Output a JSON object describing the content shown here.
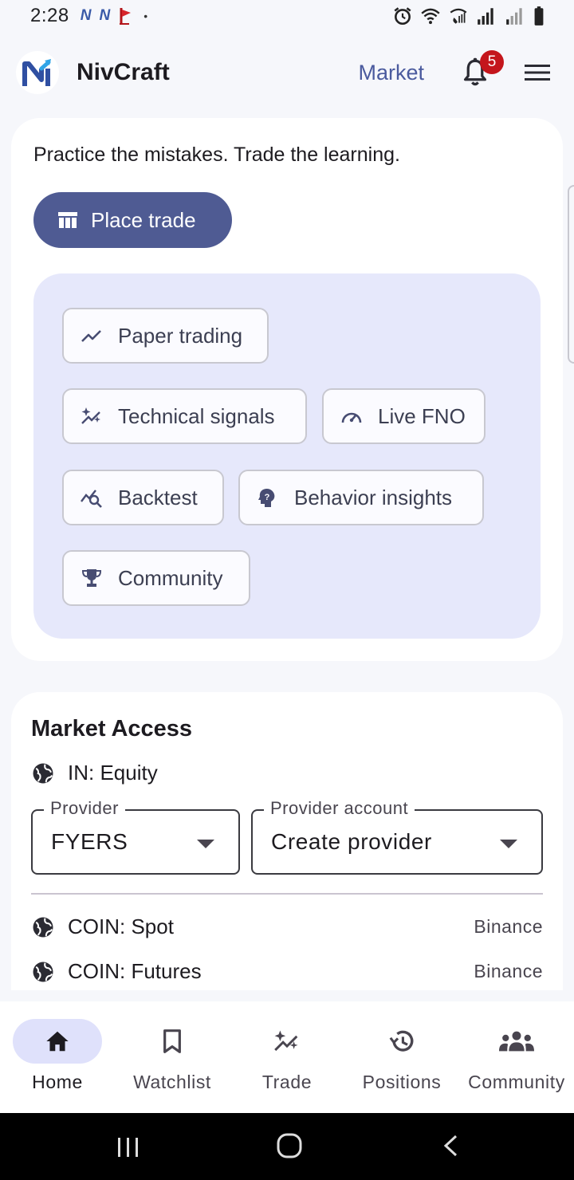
{
  "status_bar": {
    "time": "2:28",
    "notif_glyph": "N",
    "dot": "•"
  },
  "app_bar": {
    "brand": "NivCraft",
    "market_link": "Market",
    "notification_count": "5"
  },
  "hero": {
    "tagline": "Practice the mistakes. Trade the learning.",
    "place_trade_label": "Place trade",
    "features": [
      {
        "label": "Paper trading",
        "icon": "trending-up-icon"
      },
      {
        "label": "Technical signals",
        "icon": "sparkles-icon"
      },
      {
        "label": "Live FNO",
        "icon": "speedometer-icon"
      },
      {
        "label": "Backtest",
        "icon": "chart-search-icon"
      },
      {
        "label": "Behavior insights",
        "icon": "psychology-icon"
      },
      {
        "label": "Community",
        "icon": "trophy-icon"
      }
    ]
  },
  "market_access": {
    "title": "Market Access",
    "segment_in": "IN: Equity",
    "provider": {
      "label": "Provider",
      "value": "FYERS"
    },
    "provider_account": {
      "label": "Provider account",
      "value": "Create provider"
    },
    "segments": [
      {
        "label": "COIN: Spot",
        "provider": "Binance"
      },
      {
        "label": "COIN: Futures",
        "provider": "Binance"
      }
    ]
  },
  "bottom_nav": {
    "items": [
      {
        "label": "Home",
        "icon": "home-icon",
        "active": true
      },
      {
        "label": "Watchlist",
        "icon": "bookmark-icon",
        "active": false
      },
      {
        "label": "Trade",
        "icon": "sparkles-icon",
        "active": false
      },
      {
        "label": "Positions",
        "icon": "history-icon",
        "active": false
      },
      {
        "label": "Community",
        "icon": "group-icon",
        "active": false
      }
    ]
  },
  "colors": {
    "primary": "#4f5b93",
    "features_bg": "#e6e8fb",
    "badge": "#c4161c",
    "nav_active": "#dfe1fb"
  }
}
